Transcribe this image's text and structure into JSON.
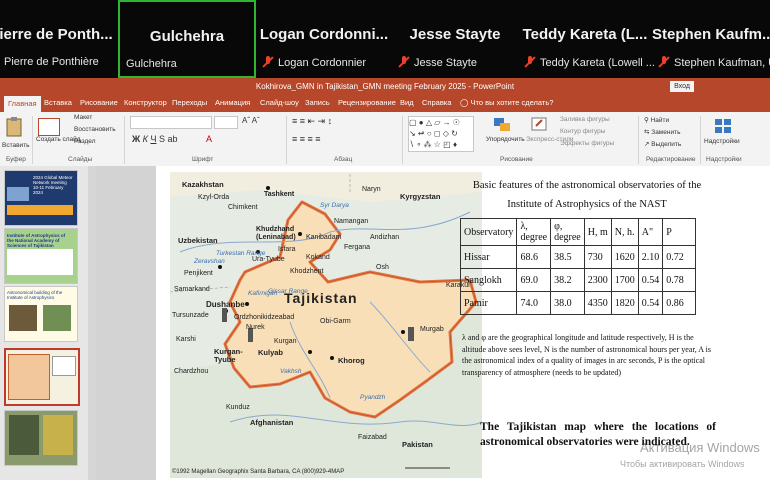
{
  "participants": [
    {
      "big": "ierre de Ponth...",
      "small": "Pierre de Ponthière",
      "muted": false,
      "active": false
    },
    {
      "big": "Gulchehra",
      "small": "Gulchehra",
      "muted": false,
      "active": true
    },
    {
      "big": "Logan Cordonni...",
      "small": "Logan Cordonnier",
      "muted": true,
      "active": false
    },
    {
      "big": "Jesse Stayte",
      "small": "Jesse Stayte",
      "muted": true,
      "active": false
    },
    {
      "big": "Teddy Kareta (L...",
      "small": "Teddy Kareta (Lowell ...",
      "muted": true,
      "active": false
    },
    {
      "big": "Stephen Kaufm...",
      "small": "Stephen Kaufman, USC",
      "muted": true,
      "active": false
    }
  ],
  "window": {
    "title": "Kokhirova_GMN in Tajikistan_GMN meeting February 2025  -  PowerPoint",
    "signin": "Вход"
  },
  "tabs": [
    "Главная",
    "Вставка",
    "Рисование",
    "Конструктор",
    "Переходы",
    "Анимация",
    "Слайд-шоу",
    "Запись",
    "Рецензирование",
    "Вид",
    "Справка",
    "Что вы хотите сделать?"
  ],
  "ribbon": {
    "paste": "Вставить",
    "create_slide": "Создать слайд",
    "layout": "Макет",
    "reset": "Восстановить",
    "section": "Раздел",
    "group_clipboard": "Буфер",
    "group_slides": "Слайды",
    "group_font": "Шрифт",
    "group_paragraph": "Абзац",
    "arrange": "Упорядочить",
    "styles": "Экспресс-стили",
    "fill": "Заливка фигуры",
    "outline": "Контур фигуры",
    "effects": "Эффекты фигуры",
    "group_drawing": "Рисование",
    "find": "Найти",
    "replace": "Заменить",
    "select": "Выделить",
    "group_editing": "Редактирование",
    "addins": "Надстройки",
    "group_addins": "Надстройки"
  },
  "thumbs": {
    "t1_text": "2024 Global Meteor Network meeting 10-11 February 2024",
    "t2_title": "Institute of Astrophysics of the National Academy of Sciences of Tajikistan",
    "t4_title": "Astronomical building of the Institute of Astrophysics"
  },
  "map": {
    "title": "Tajikistan",
    "credit": "©1992 Magellan Geographix Santa Barbara, CA (800)929-4MAP",
    "countries": [
      "Kazakhstan",
      "Kyrgyzstan",
      "Uzbekistan",
      "Afghanistan",
      "Pakistan"
    ],
    "cities": [
      "Tashkent",
      "Khudzhand (Leninabad)",
      "Kanibadam",
      "Dushanbe",
      "Ordzhonikidzeabad",
      "Nurek",
      "Kulyab",
      "Kurgan-Tyube",
      "Khorog",
      "Murgab",
      "Tursunzade",
      "Penjikent",
      "Ura-Tyube",
      "Isfara"
    ],
    "extra": [
      "Gissar Range",
      "Vakhsh",
      "Pyandzh",
      "Syr Darya",
      "Zeravshan",
      "Turkestan Range",
      "Kokand",
      "Osh",
      "Naryn",
      "Andizhan",
      "Fergana",
      "Namangan",
      "Chardzhou",
      "Karshi",
      "Samarkand",
      "Kzyl-Orda",
      "Chimkent",
      "Kurgan",
      "Khodzhent",
      "Kafirnigan",
      "Karakul",
      "Obi-Garm",
      "Faizabad",
      "Kunduz"
    ]
  },
  "caption": "Basic features of the astronomical observatories of the Institute of Astrophysics of the NAST",
  "table": {
    "headers": [
      "Observatory",
      "λ, degree",
      "φ, degree",
      "H, m",
      "N, h.",
      "A\"",
      "P"
    ],
    "rows": [
      [
        "Hissar",
        "68.6",
        "38.5",
        "730",
        "1620",
        "2.10",
        "0.72"
      ],
      [
        "Sanglokh",
        "69.0",
        "38.2",
        "2300",
        "1700",
        "0.54",
        "0.78"
      ],
      [
        "Pamir",
        "74.0",
        "38.0",
        "4350",
        "1820",
        "0.54",
        "0.86"
      ]
    ]
  },
  "note": "λ and φ are the geographical longitude and latitude respectively, H is the altitude above sees level, N is the number of astronomical hours per year, A is the astronomical index of a quality of images in arc seconds, P is the optical transparency of atmosphere (needs to be updated)",
  "map_caption": "The Tajikistan map where the locations of astronomical observatories were indicated.",
  "watermark": {
    "line1": "Активация Windows",
    "line2": "Чтобы активировать Windows"
  }
}
